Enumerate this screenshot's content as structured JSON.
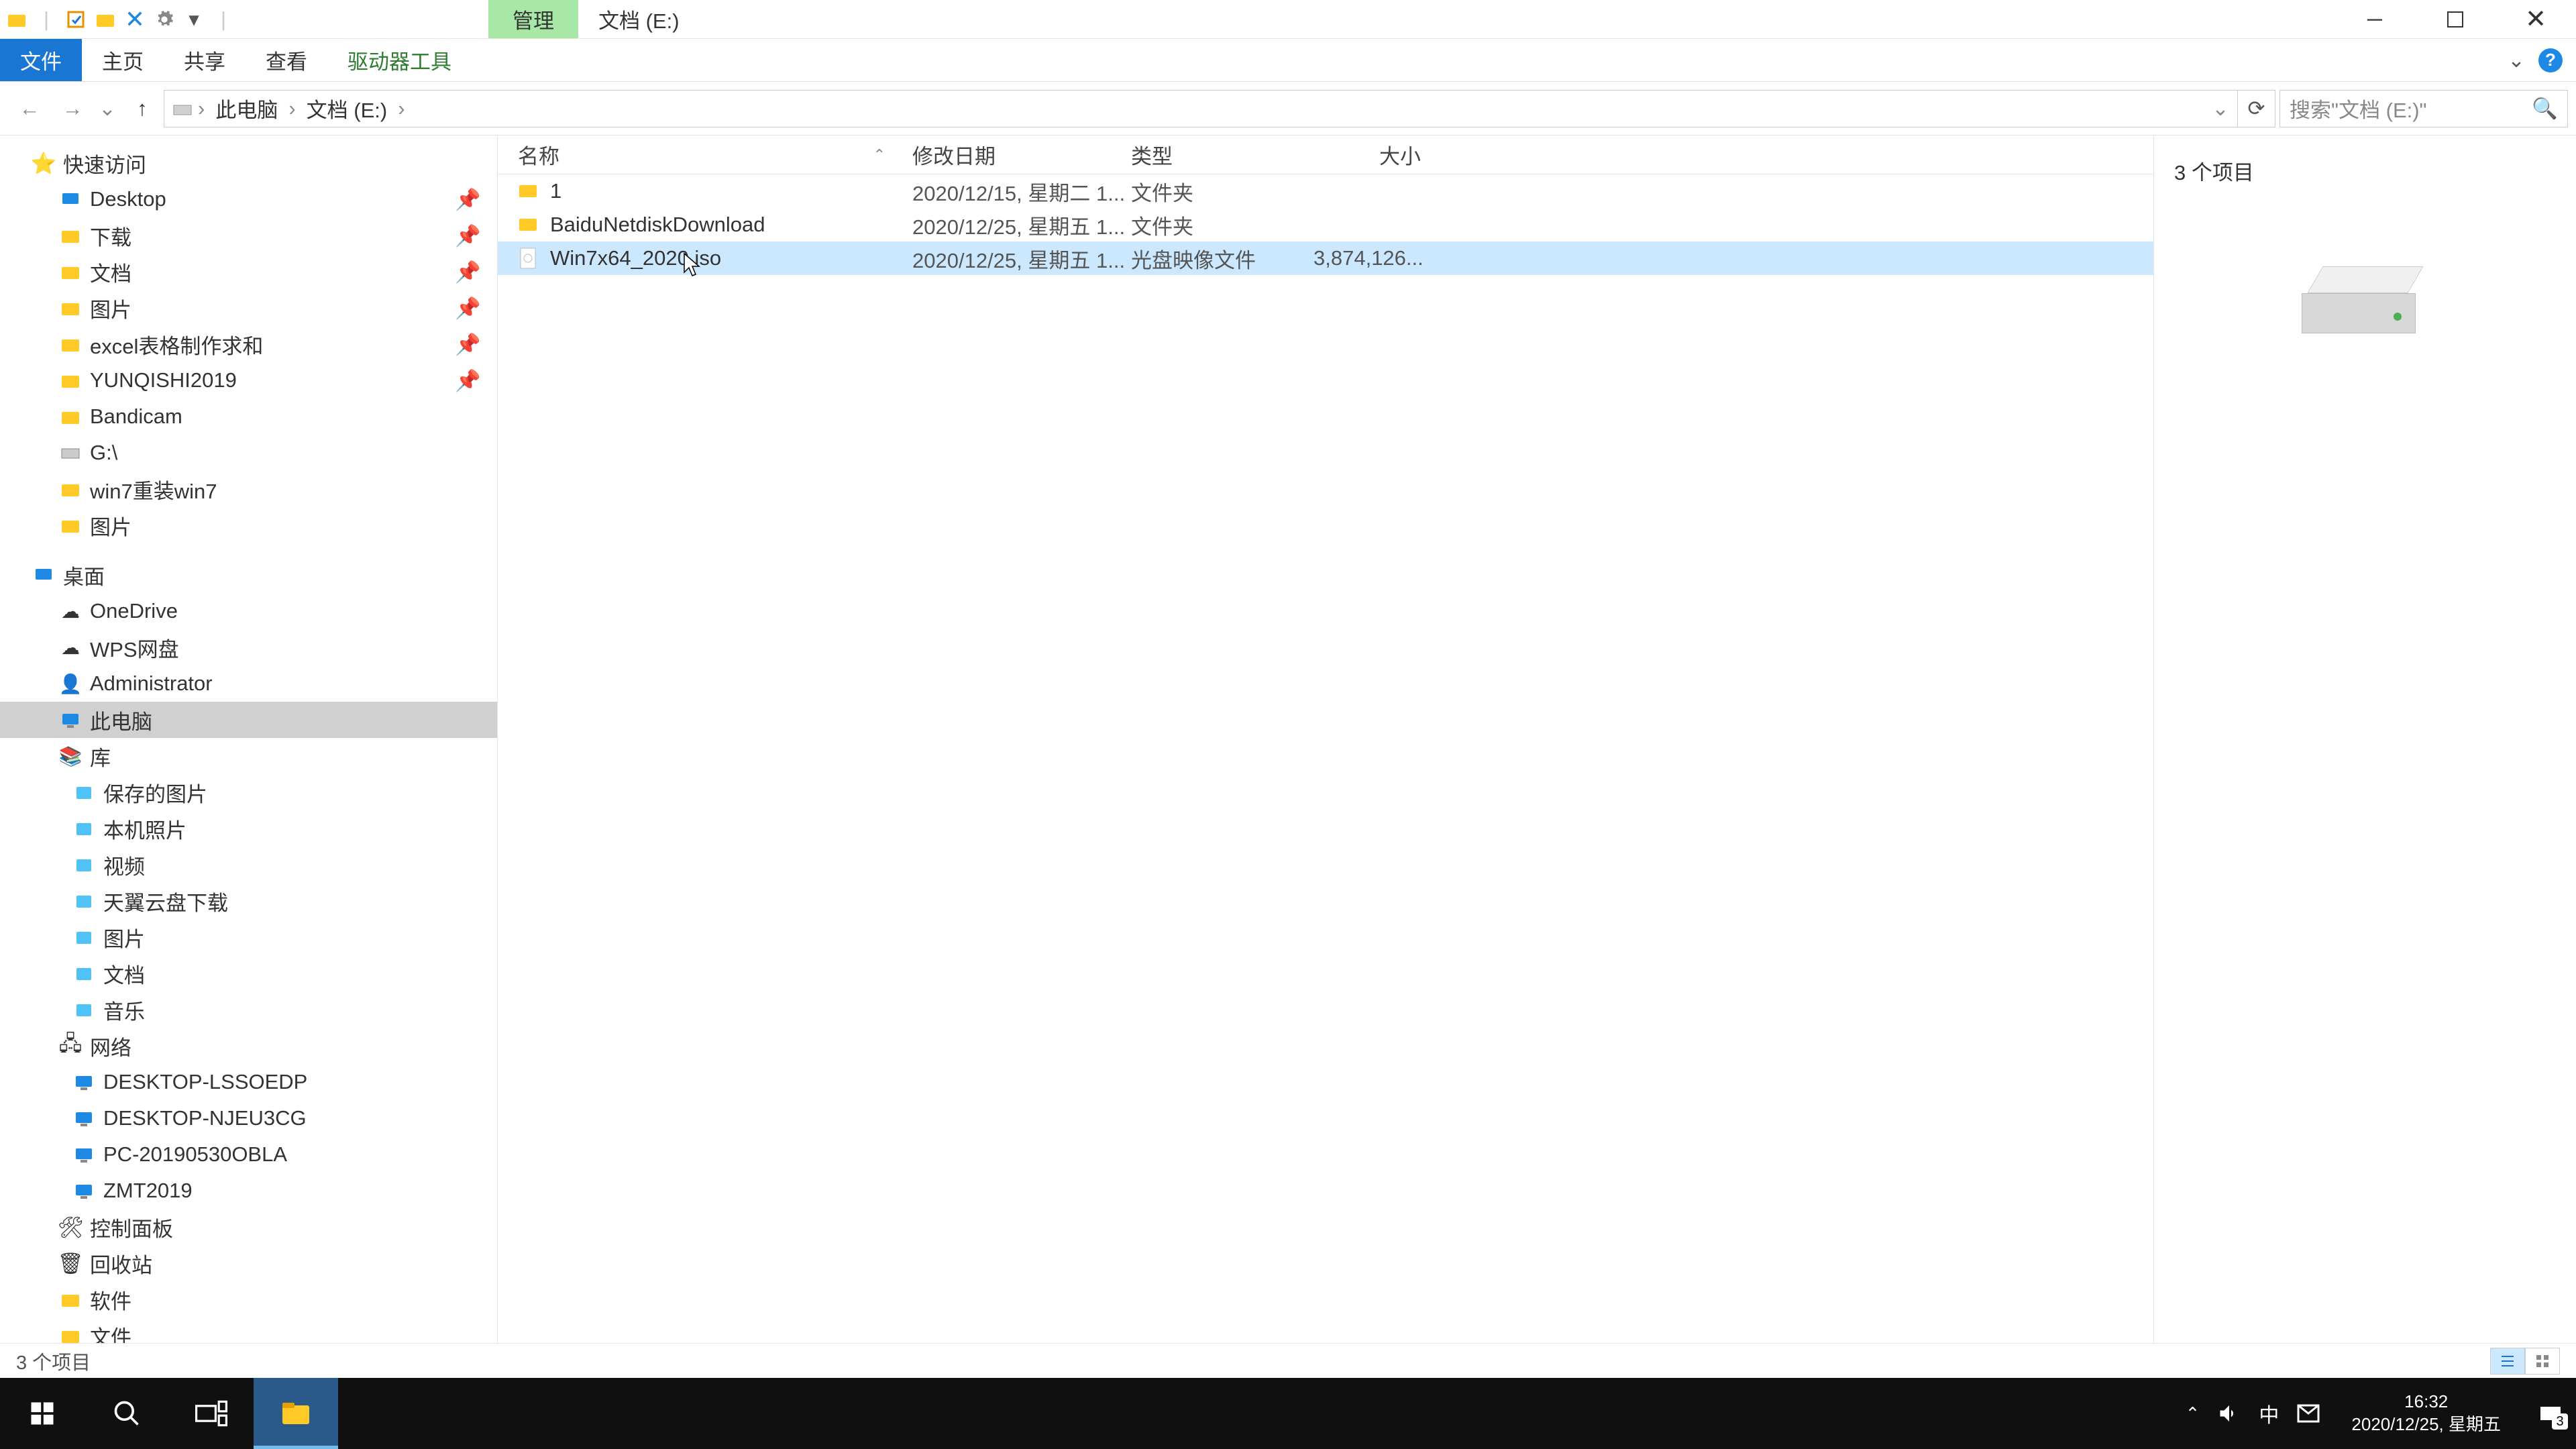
{
  "title": {
    "contextual": "管理",
    "location": "文档 (E:)"
  },
  "ribbon": {
    "file": "文件",
    "home": "主页",
    "share": "共享",
    "view": "查看",
    "drive_tools": "驱动器工具"
  },
  "breadcrumb": {
    "root": "此电脑",
    "current": "文档 (E:)"
  },
  "search": {
    "placeholder": "搜索\"文档 (E:)\""
  },
  "columns": {
    "name": "名称",
    "date": "修改日期",
    "type": "类型",
    "size": "大小"
  },
  "files": [
    {
      "name": "1",
      "date": "2020/12/15, 星期二 1...",
      "type": "文件夹",
      "size": "",
      "kind": "folder"
    },
    {
      "name": "BaiduNetdiskDownload",
      "date": "2020/12/25, 星期五 1...",
      "type": "文件夹",
      "size": "",
      "kind": "folder"
    },
    {
      "name": "Win7x64_2020.iso",
      "date": "2020/12/25, 星期五 1...",
      "type": "光盘映像文件",
      "size": "3,874,126...",
      "kind": "iso"
    }
  ],
  "nav": {
    "quick": "快速访问",
    "quick_items": [
      "Desktop",
      "下载",
      "文档",
      "图片",
      "excel表格制作求和",
      "YUNQISHI2019",
      "Bandicam",
      "G:\\",
      "win7重装win7",
      "图片"
    ],
    "desktop": "桌面",
    "desktop_items": [
      "OneDrive",
      "WPS网盘",
      "Administrator",
      "此电脑",
      "库"
    ],
    "lib_items": [
      "保存的图片",
      "本机照片",
      "视频",
      "天翼云盘下载",
      "图片",
      "文档",
      "音乐"
    ],
    "network": "网络",
    "net_items": [
      "DESKTOP-LSSOEDP",
      "DESKTOP-NJEU3CG",
      "PC-20190530OBLA",
      "ZMT2019"
    ],
    "ctrl": "控制面板",
    "recycle": "回收站",
    "soft": "软件",
    "docs": "文件"
  },
  "preview": {
    "count": "3 个项目"
  },
  "status": {
    "text": "3 个项目"
  },
  "tray": {
    "ime": "中",
    "time": "16:32",
    "date": "2020/12/25, 星期五",
    "notif": "3"
  }
}
